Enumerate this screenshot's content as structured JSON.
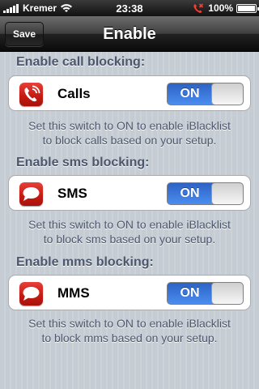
{
  "status_bar": {
    "carrier": "Kremer",
    "time": "23:38",
    "battery_percent": "100%",
    "battery_level": 1.0,
    "signal_bars": 5
  },
  "nav": {
    "title": "Enable",
    "save_label": "Save"
  },
  "sections": [
    {
      "header": "Enable call blocking:",
      "label": "Calls",
      "icon": "phone-icon",
      "toggle": "ON",
      "footer_line1": "Set this switch to ON to enable iBlacklist",
      "footer_line2": "to block calls based on your setup."
    },
    {
      "header": "Enable sms blocking:",
      "label": "SMS",
      "icon": "speech-bubble-icon",
      "toggle": "ON",
      "footer_line1": "Set this switch to ON to enable iBlacklist",
      "footer_line2": "to block sms based on your setup."
    },
    {
      "header": "Enable mms blocking:",
      "label": "MMS",
      "icon": "speech-bubble-icon",
      "toggle": "ON",
      "footer_line1": "Set this switch to ON to enable iBlacklist",
      "footer_line2": "to block mms based on your setup."
    }
  ],
  "colors": {
    "accent_toggle": "#3a7ae0",
    "icon_red": "#c61c14",
    "header_text": "#4c566c"
  }
}
